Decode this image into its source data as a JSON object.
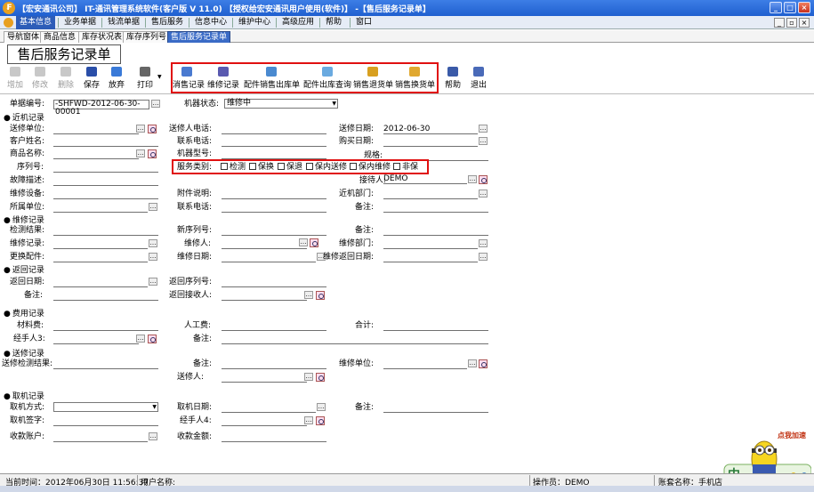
{
  "window": {
    "title": "【宏安通讯公司】 IT-通讯管理系统软件(客户版 V 11.0) 【授权给宏安通讯用户使用(软件)】 -【售后服务记录单】",
    "min": "_",
    "max": "□",
    "close": "×"
  },
  "menu": [
    "基本信息",
    "业务单据",
    "钱流单据",
    "售后服务",
    "信息中心",
    "维护中心",
    "高级应用",
    "帮助",
    "窗口"
  ],
  "tabs": [
    "导航窗体",
    "商品信息",
    "库存状况表",
    "库存序列号",
    "售后服务记录单"
  ],
  "form_title": "售后服务记录单",
  "toolbar": {
    "left": [
      "增加",
      "修改",
      "删除",
      "保存",
      "放弃",
      "打印"
    ],
    "mid": [
      "消售记录",
      "维修记录",
      "配件销售出库单",
      "配件出库查询",
      "销售退货单",
      "销售换货单"
    ],
    "right": [
      "帮助",
      "退出"
    ]
  },
  "header": {
    "doc_no_label": "单据编号:",
    "doc_no": "-SHFWD-2012-06-30-00001",
    "machine_status_label": "机器状态:",
    "machine_status": "维修中"
  },
  "sections": {
    "send": "近机记录",
    "repair": "维修记录",
    "return": "返回记录",
    "fee": "费用记录",
    "sendrepair": "送修记录",
    "pickup": "取机记录"
  },
  "labels": {
    "send_unit": "送修单位:",
    "send_phone": "送修人电话:",
    "send_date": "送修日期:",
    "send_date_value": "2012-06-30",
    "cust_name": "客户姓名:",
    "contact_phone": "联系电话:",
    "buy_date": "购买日期:",
    "goods_name": "商品名称:",
    "machine_model": "机器型号:",
    "spec": "规格:",
    "serial_no": "序列号:",
    "service_type": "服务类别:",
    "fault_desc": "故障描述:",
    "receiver": "接待人:",
    "receiver_value": "DEMO",
    "repair_equip": "维修设备:",
    "attach_note": "附件说明:",
    "send_dept": "近机部门:",
    "belong_unit": "所属单位:",
    "contact_phone2": "联系电话:",
    "remark": "备注:",
    "check_result": "检测结果:",
    "repair_record": "维修记录:",
    "replace_parts": "更换配件:",
    "new_serial": "新序列号:",
    "repairer": "维修人:",
    "repair_date": "维修日期:",
    "repair_remark": "备注:",
    "repair_dept": "维修部门:",
    "repair_return_date": "维修返回日期:",
    "return_date": "返回日期:",
    "return_remark": "备注:",
    "return_serial": "返回序列号:",
    "return_receiver": "返回接收人:",
    "material_fee": "材料费:",
    "handler3": "经手人3:",
    "labor_fee": "人工费:",
    "fee_remark": "备注:",
    "total": "合计:",
    "send_check_result": "送修检测结果:",
    "send_person": "送修人:",
    "send_remark": "备注:",
    "repair_unit": "维修单位:",
    "pickup_method": "取机方式:",
    "pickup_sign": "取机签字:",
    "receive_account": "收款账户:",
    "pickup_date": "取机日期:",
    "handler4": "经手人4:",
    "receive_amount": "收款金额:",
    "pickup_remark": "备注:"
  },
  "service_types": [
    "检测",
    "保换",
    "保退",
    "保内送修",
    "保内维修",
    "非保"
  ],
  "status": {
    "time": "当前时间：2012年06月30日  11:56:37",
    "user": "用户名称:",
    "operator": "操作员：DEMO",
    "account": "账套名称：手机店"
  },
  "mascot_label": "点我加速",
  "colors": {
    "accent_red": "#e01010",
    "title_blue": "#1f5fcf",
    "tab_active": "#3a6bc6"
  }
}
